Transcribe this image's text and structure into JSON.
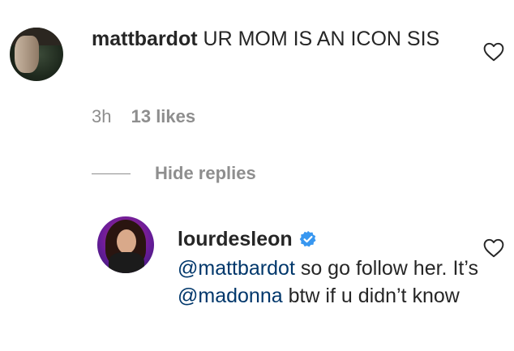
{
  "comment": {
    "username": "mattbardot",
    "text": "UR MOM IS AN ICON SIS",
    "time": "3h",
    "likes": "13 likes"
  },
  "replies_toggle": {
    "label": "Hide replies"
  },
  "reply": {
    "username": "lourdesleon",
    "verified": true,
    "mention_1": "@mattbardot",
    "text_1": " so go follow her. It’s ",
    "mention_2": "@madonna",
    "text_2": " btw if u didn’t know"
  },
  "icons": {
    "like": "heart-icon",
    "verified": "verified-badge-icon",
    "verified_color": "#3897f0"
  },
  "colors": {
    "text": "#262626",
    "secondary": "#8e8e8e",
    "link": "#00376b"
  }
}
